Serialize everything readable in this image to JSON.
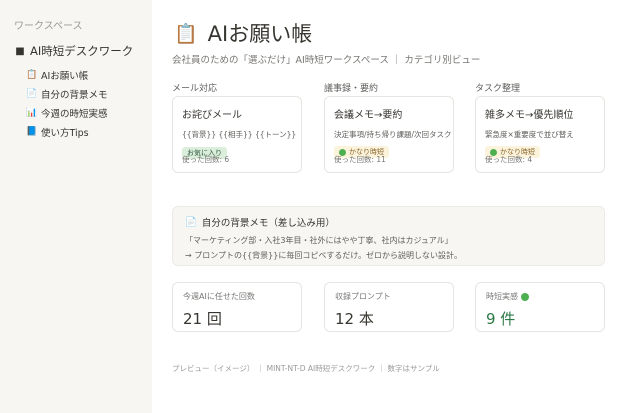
{
  "sidebar": {
    "workspace_label": "ワークスペース",
    "root": {
      "icon": "folder-icon",
      "glyph": "🖿",
      "label": "AI時短デスクワーク"
    },
    "items": [
      {
        "icon": "clipboard-icon",
        "glyph": "📋",
        "label": "AIお願い帳"
      },
      {
        "icon": "memo-icon",
        "glyph": "📄",
        "label": "自分の背景メモ"
      },
      {
        "icon": "chart-icon",
        "glyph": "📊",
        "label": "今週の時短実感"
      },
      {
        "icon": "book-icon",
        "glyph": "📘",
        "label": "使い方Tips"
      }
    ]
  },
  "page": {
    "icon_glyph": "📋",
    "title": "AIお願い帳",
    "subtitle": "会社員のための「選ぶだけ」AI時短ワークスペース ｜ カテゴリ別ビュー"
  },
  "columns": [
    {
      "label": "メール対応",
      "card": {
        "title": "お詫びメール",
        "desc": "{{背景}} {{相手}} {{トーン}}",
        "badge": "お気に入り",
        "badge_style": "green",
        "used": "使った回数: 6"
      }
    },
    {
      "label": "議事録・要約",
      "card": {
        "title": "会議メモ→要約",
        "desc": "決定事項/持ち帰り課題/次回タスク",
        "badge": "かなり時短",
        "badge_style": "yellow",
        "used": "使った回数: 11"
      }
    },
    {
      "label": "タスク整理",
      "card": {
        "title": "雑多メモ→優先順位",
        "desc": "緊急度×重要度で並び替え",
        "badge": "かなり時短",
        "badge_style": "yellow",
        "used": "使った回数: 4"
      }
    }
  ],
  "memo": {
    "title": "自分の背景メモ（差し込み用）",
    "line1": "「マーケティング部・入社3年目・社外にはやや丁寧、社内はカジュアル」",
    "line2": "→ プロンプトの{{背景}}に毎回コピペするだけ。ゼロから説明しない設計。"
  },
  "stats": [
    {
      "label": "今週AIに任せた回数",
      "value": "21 回",
      "has_dot": false
    },
    {
      "label": "収録プロンプト",
      "value": "12 本",
      "has_dot": false
    },
    {
      "label": "時短実感",
      "value": "9 件",
      "has_dot": true
    }
  ],
  "footer": "プレビュー（イメージ） ｜ MINT-NT-D AI時短デスクワーク ｜ 数字はサンプル",
  "colors": {
    "sidebar_bg": "#f7f6f3",
    "badge_green_bg": "#dbeddb",
    "badge_yellow_bg": "#fbf3db",
    "accent_green": "#4caf50",
    "stat_green": "#2b7a46"
  }
}
